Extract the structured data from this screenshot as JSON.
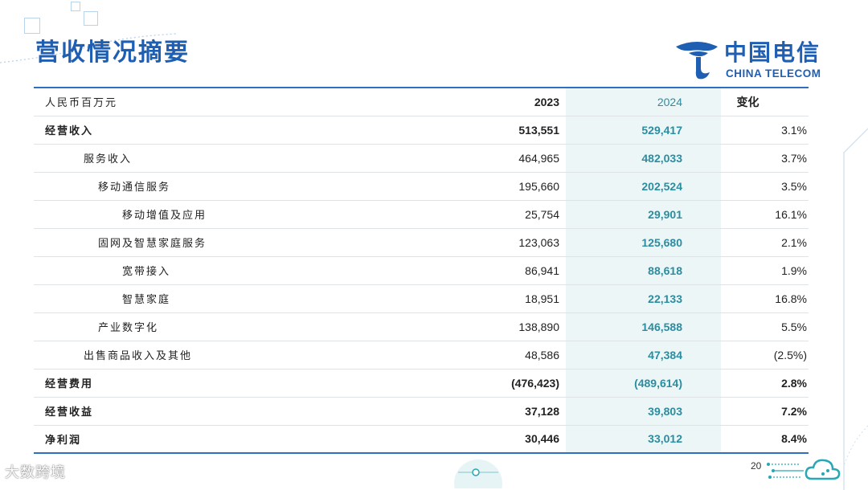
{
  "slide": {
    "title": "营收情况摘要",
    "page_number": "20",
    "watermark": "大数跨境"
  },
  "logo": {
    "chinese": "中国电信",
    "english": "CHINA TELECOM"
  },
  "table": {
    "header": {
      "label": "人民币百万元",
      "y2023": "2023",
      "y2024": "2024",
      "change": "变化"
    },
    "rows": [
      {
        "label": "经营收入",
        "y2023": "513,551",
        "y2024": "529,417",
        "change": "3.1%"
      },
      {
        "label": "服务收入",
        "y2023": "464,965",
        "y2024": "482,033",
        "change": "3.7%"
      },
      {
        "label": "移动通信服务",
        "y2023": "195,660",
        "y2024": "202,524",
        "change": "3.5%"
      },
      {
        "label": "移动增值及应用",
        "y2023": "25,754",
        "y2024": "29,901",
        "change": "16.1%"
      },
      {
        "label": "固网及智慧家庭服务",
        "y2023": "123,063",
        "y2024": "125,680",
        "change": "2.1%"
      },
      {
        "label": "宽带接入",
        "y2023": "86,941",
        "y2024": "88,618",
        "change": "1.9%"
      },
      {
        "label": "智慧家庭",
        "y2023": "18,951",
        "y2024": "22,133",
        "change": "16.8%"
      },
      {
        "label": "产业数字化",
        "y2023": "138,890",
        "y2024": "146,588",
        "change": "5.5%"
      },
      {
        "label": "出售商品收入及其他",
        "y2023": "48,586",
        "y2024": "47,384",
        "change": "(2.5%)"
      },
      {
        "label": "经营费用",
        "y2023": "(476,423)",
        "y2024": "(489,614)",
        "change": "2.8%"
      },
      {
        "label": "经营收益",
        "y2023": "37,128",
        "y2024": "39,803",
        "change": "7.2%"
      },
      {
        "label": "净利润",
        "y2023": "30,446",
        "y2024": "33,012",
        "change": "8.4%"
      }
    ]
  },
  "colors": {
    "title_blue": "#1f5fb3",
    "rule_blue": "#2e6fc1",
    "value_2024": "#2a8da0"
  }
}
